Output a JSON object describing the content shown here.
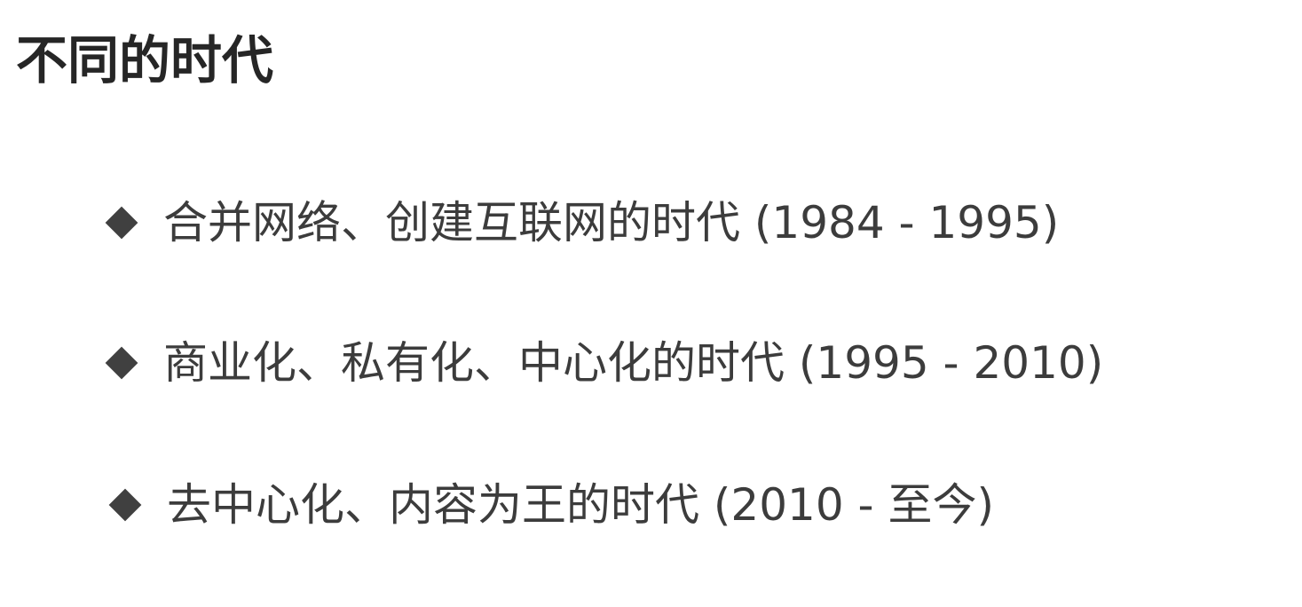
{
  "slide": {
    "title": "不同的时代",
    "bullets": [
      {
        "text": "合并网络、创建互联网的时代 (1984 - 1995)",
        "marker_icon": "diamond-bullet-icon"
      },
      {
        "text": "商业化、私有化、中心化的时代 (1995 - 2010)",
        "marker_icon": "diamond-bullet-icon"
      },
      {
        "text": "去中心化、内容为王的时代 (2010 - 至今)",
        "marker_icon": "diamond-bullet-icon"
      }
    ],
    "colors": {
      "title": "#262626",
      "text": "#3c3c3c",
      "bullet": "#404040",
      "background": "#ffffff"
    }
  }
}
